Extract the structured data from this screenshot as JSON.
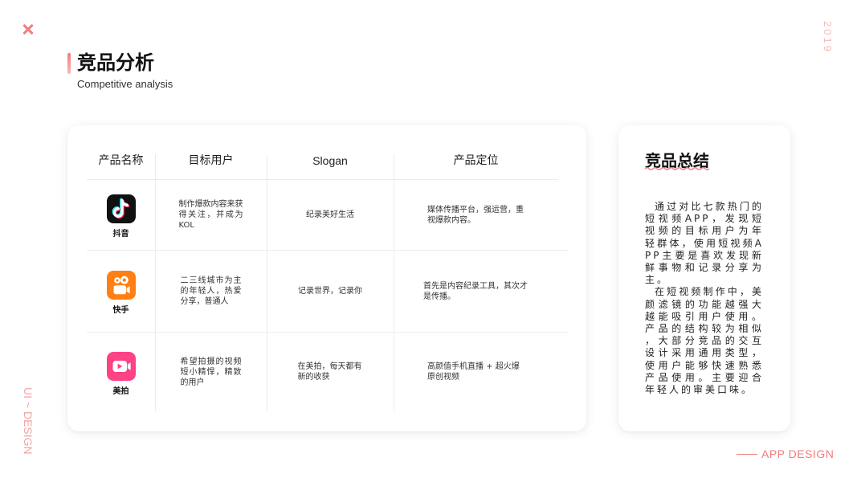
{
  "slide": {
    "title": "竞品分析",
    "subtitle": "Competitive analysis",
    "year": "2019",
    "side_label": "UI ~ DESIGN",
    "footer_label": "APP DESIGN",
    "corner_icon": "x-mark-icon"
  },
  "colors": {
    "accent": "#f27c7c",
    "accent_light": "#f6b9b9",
    "side_label": "#f2a3a3",
    "divider": "#ececec",
    "text": "#1a1a1a"
  },
  "table": {
    "headers": [
      "产品名称",
      "目标用户",
      "Slogan",
      "产品定位"
    ],
    "rows": [
      {
        "product": "抖音",
        "icon": "douyin-app-icon",
        "brand_color": "#111111",
        "target_users": "制作爆款内容来获得关注，并成为KOL",
        "slogan": "纪录美好生活",
        "positioning": "媒体传播平台，强运营，重视爆款内容。"
      },
      {
        "product": "快手",
        "icon": "kuaishou-app-icon",
        "brand_color": "#ff7f14",
        "target_users": "二三线城市为主的年轻人，热爱分享，普通人",
        "slogan": "记录世界，记录你",
        "positioning": "首先是内容纪录工具，其次才是传播。"
      },
      {
        "product": "美拍",
        "icon": "meipai-app-icon",
        "brand_color": "#ff4185",
        "target_users": "希望拍摄的视频短小精悍，精致的用户",
        "slogan": "在美拍，每天都有新的收获",
        "positioning": "高颜值手机直播 + 超火爆原创视频"
      }
    ]
  },
  "summary": {
    "title": "竞品总结",
    "paragraphs": [
      "通过对比七款热门的短视频APP，发现短视频的目标用户为年轻群体，使用短视频APP主要是喜欢发现新鲜事物和记录分享为主。",
      "在短视频制作中，美颜滤镜的功能越强大越能吸引用户使用。产品的结构较为相似，大部分竞品的交互设计采用通用类型，使用户能够快速熟悉产品使用。主要迎合年轻人的审美口味。"
    ]
  }
}
